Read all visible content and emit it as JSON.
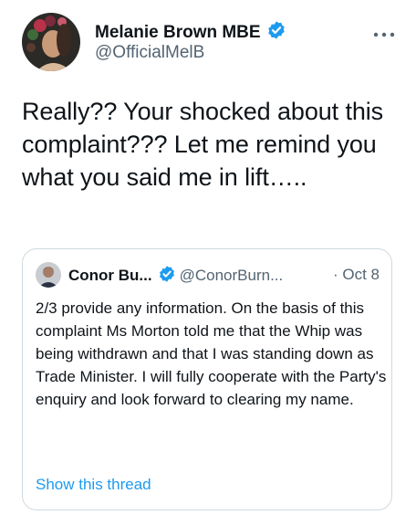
{
  "author": {
    "display_name": "Melanie Brown MBE",
    "handle": "@OfficialMelB"
  },
  "tweet": {
    "text": "Really?? Your shocked about this complaint??? Let me remind you what you said me in lift….."
  },
  "quoted_tweet": {
    "display_name": "Conor Bu...",
    "handle": "@ConorBurn...",
    "date": "· Oct 8",
    "text": "2/3 provide any information.  On the basis of this complaint Ms Morton told me that the Whip was being withdrawn and that I was standing down as Trade Minister. I will fully cooperate with the Party's enquiry and look forward to clearing my name.",
    "show_thread_label": "Show this thread"
  },
  "colors": {
    "verified_badge": "#1d9bf0",
    "link": "#1d9bf0",
    "secondary_text": "#536471",
    "border": "#cfd9de"
  },
  "icons": [
    "verified-badge-icon",
    "more-options-icon"
  ]
}
